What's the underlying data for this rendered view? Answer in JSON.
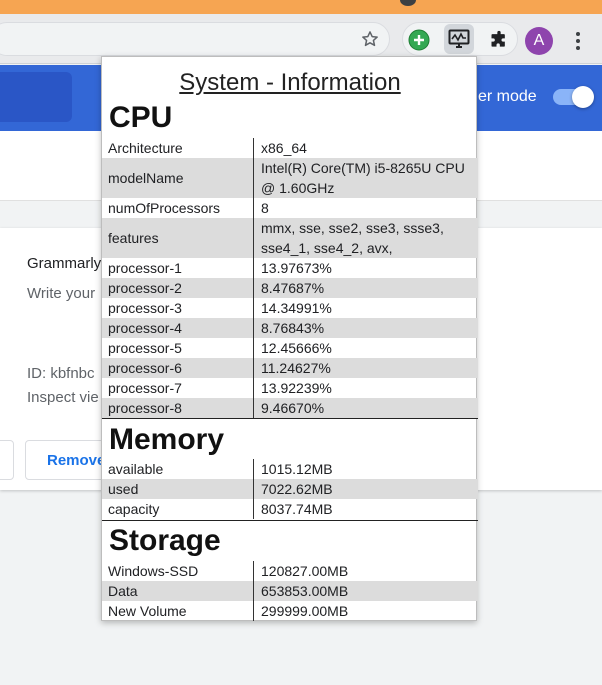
{
  "page": {
    "remove_button": "Remove",
    "developer_mode_label": "er mode",
    "extension_card": {
      "name": "Grammarly",
      "description": "Write your",
      "id_text": "ID: kbfnbc",
      "inspect_text": "Inspect vie"
    }
  },
  "toolbar": {
    "avatar_letter": "A",
    "colors": {
      "top_strip": "#f6a552",
      "header_blue": "#3367d6",
      "avatar": "#8e44ad",
      "toggle_track": "#8ab4f8"
    }
  },
  "popup": {
    "title": "System - Information",
    "cpu": {
      "heading": "CPU",
      "rows": [
        {
          "key": "Architecture",
          "value": "x86_64"
        },
        {
          "key": "modelName",
          "value": "Intel(R) Core(TM) i5-8265U CPU @ 1.60GHz"
        },
        {
          "key": "numOfProcessors",
          "value": "8"
        },
        {
          "key": "features",
          "value": "mmx, sse, sse2, sse3, ssse3, sse4_1, sse4_2, avx,"
        },
        {
          "key": "processor-1",
          "value": "13.97673%"
        },
        {
          "key": "processor-2",
          "value": "8.47687%"
        },
        {
          "key": "processor-3",
          "value": "14.34991%"
        },
        {
          "key": "processor-4",
          "value": "8.76843%"
        },
        {
          "key": "processor-5",
          "value": "12.45666%"
        },
        {
          "key": "processor-6",
          "value": "11.24627%"
        },
        {
          "key": "processor-7",
          "value": "13.92239%"
        },
        {
          "key": "processor-8",
          "value": "9.46670%"
        }
      ]
    },
    "memory": {
      "heading": "Memory",
      "rows": [
        {
          "key": "available",
          "value": "1015.12MB"
        },
        {
          "key": "used",
          "value": "7022.62MB"
        },
        {
          "key": "capacity",
          "value": "8037.74MB"
        }
      ]
    },
    "storage": {
      "heading": "Storage",
      "rows": [
        {
          "key": "Windows-SSD",
          "value": "120827.00MB"
        },
        {
          "key": "Data",
          "value": "653853.00MB"
        },
        {
          "key": "New Volume",
          "value": "299999.00MB"
        }
      ]
    }
  }
}
